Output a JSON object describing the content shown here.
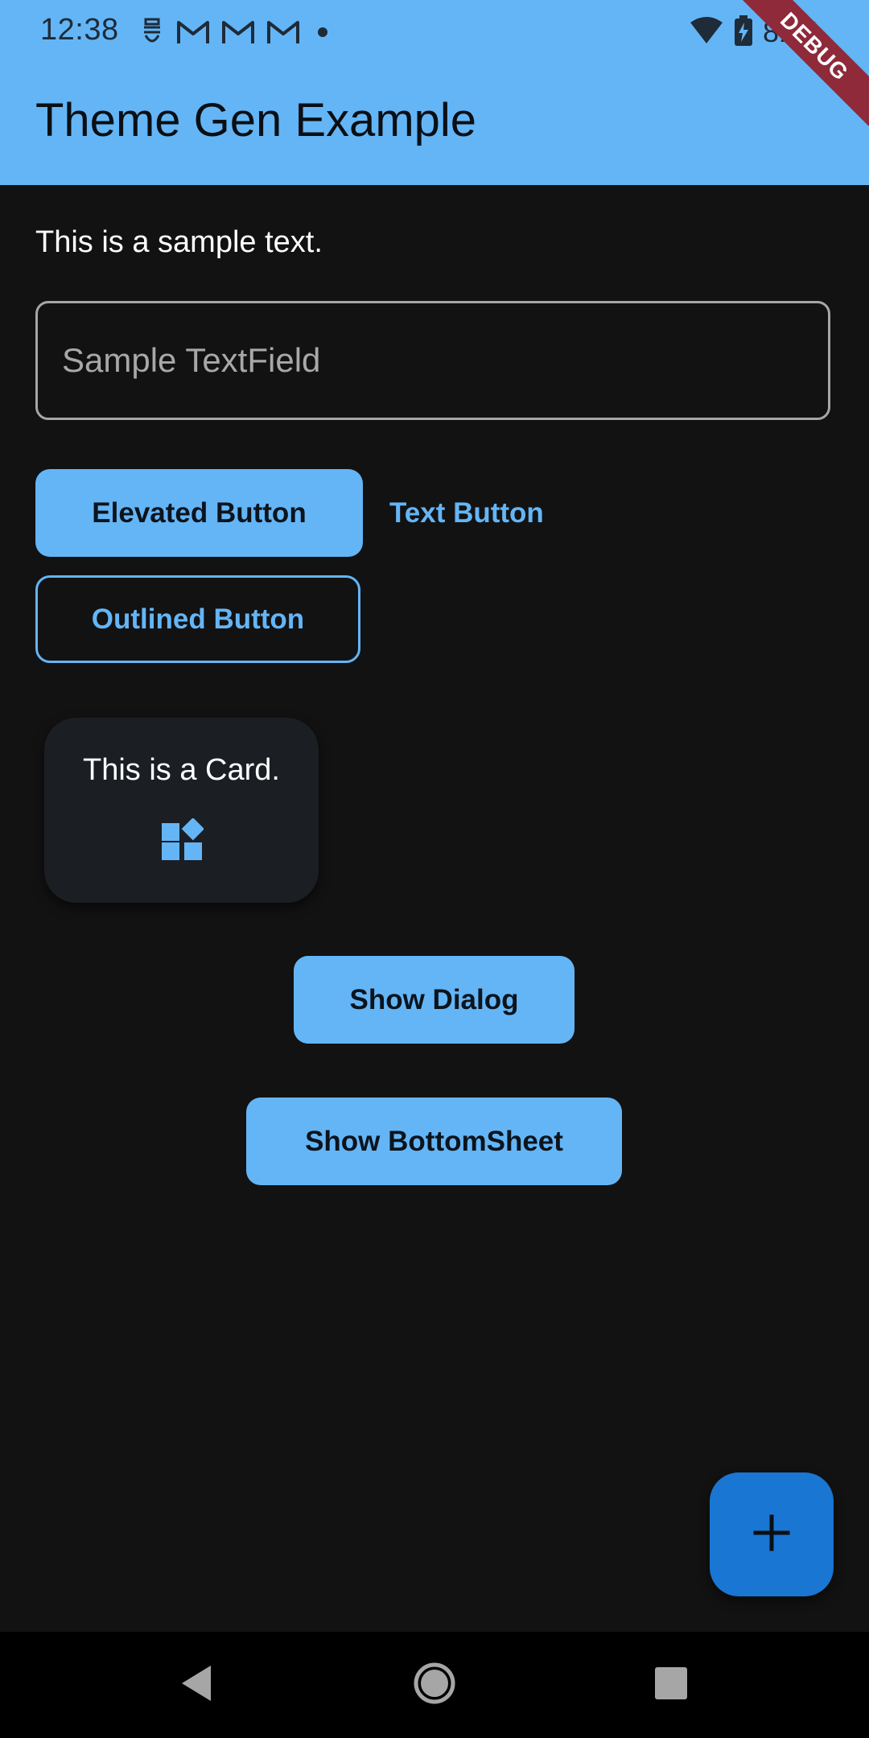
{
  "status_bar": {
    "time": "12:38",
    "battery": "81%",
    "icons_left": [
      "storage-icon",
      "gmail-icon",
      "gmail-icon",
      "gmail-icon",
      "notification-dot-icon"
    ],
    "icons_right": [
      "wifi-icon",
      "battery-charging-icon"
    ]
  },
  "app_bar": {
    "title": "Theme Gen Example"
  },
  "debug_banner": "DEBUG",
  "body": {
    "sample_text": "This is a sample text.",
    "text_field_placeholder": "Sample TextField",
    "elevated_button": "Elevated Button",
    "text_button": "Text Button",
    "outlined_button": "Outlined Button",
    "card_text": "This is a Card.",
    "card_icon": "widgets-icon",
    "show_dialog_button": "Show Dialog",
    "show_bottomsheet_button": "Show BottomSheet"
  },
  "fab": {
    "icon": "add-icon"
  },
  "nav_bar": {
    "buttons": [
      "back-icon",
      "home-icon",
      "recents-icon"
    ]
  },
  "colors": {
    "primary": "#64b5f6",
    "fab": "#1976d2",
    "background": "#121212",
    "card": "#1b1e23",
    "debug": "#8e2a3a"
  }
}
